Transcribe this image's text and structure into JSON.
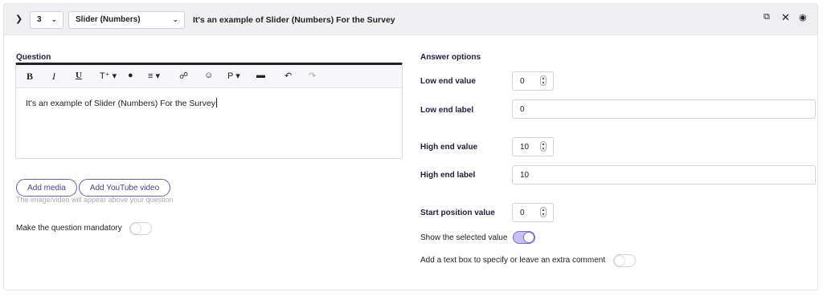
{
  "header": {
    "expand_icon": "chevron-right-icon",
    "question_number": "3",
    "question_type": "Slider (Numbers)",
    "question_title": "It's an example of Slider (Numbers) For the Survey",
    "actions": [
      "duplicate-icon",
      "close-icon",
      "eye-icon"
    ]
  },
  "question": {
    "label": "Question",
    "toolbar": [
      "bold",
      "italic",
      "underline",
      "font-size",
      "color",
      "align",
      "link",
      "emoji",
      "paragraph",
      "clear-format",
      "undo",
      "redo"
    ],
    "text": "It's an example of Slider (Numbers) For the Survey"
  },
  "media": {
    "add_media_label": "Add media",
    "add_youtube_label": "Add YouTube video",
    "hint": "The image/video will appear above your question"
  },
  "mandatory": {
    "label": "Make the question mandatory",
    "enabled": false
  },
  "answer_options": {
    "label": "Answer options",
    "low_end_value_label": "Low end value",
    "low_end_value": "0",
    "low_end_label_label": "Low end label",
    "low_end_label": "0",
    "high_end_value_label": "High end value",
    "high_end_value": "10",
    "high_end_label_label": "High end label",
    "high_end_label": "10",
    "start_position_label": "Start position value",
    "start_position_value": "0",
    "show_selected_label": "Show the selected value",
    "show_selected_enabled": true,
    "extra_comment_label": "Add a text box to specify or leave an extra comment",
    "extra_comment_enabled": false
  },
  "colors": {
    "accent": "#6b5fa8",
    "toggle_on": "#c9bff0",
    "header_bg": "#f0f0f3"
  }
}
